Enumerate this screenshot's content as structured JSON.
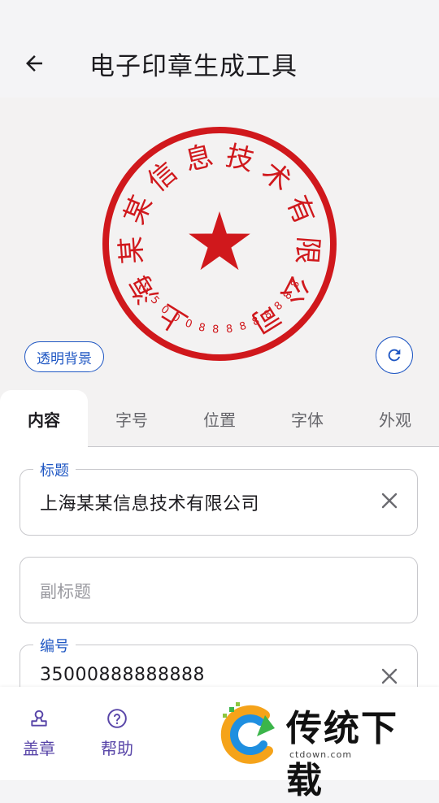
{
  "appbar": {
    "title": "电子印章生成工具"
  },
  "seal": {
    "title_text": "上海某某信息技术有限公司",
    "number_text": "35000888888888",
    "color": "#d0181c"
  },
  "preview": {
    "transparent_bg_label": "透明背景"
  },
  "tabs": [
    {
      "label": "内容",
      "active": true
    },
    {
      "label": "字号",
      "active": false
    },
    {
      "label": "位置",
      "active": false
    },
    {
      "label": "字体",
      "active": false
    },
    {
      "label": "外观",
      "active": false
    }
  ],
  "form": {
    "title_field": {
      "label": "标题",
      "value": "上海某某信息技术有限公司"
    },
    "subtitle_field": {
      "placeholder": "副标题"
    },
    "number_field": {
      "label": "编号",
      "value": "35000888888888"
    }
  },
  "bottom_nav": {
    "stamp_label": "盖章",
    "help_label": "帮助"
  },
  "watermark": {
    "text": "传统下载",
    "sub": "ctdown.com"
  },
  "colors": {
    "accent": "#1f57c3",
    "nav_purple": "#5845a8",
    "seal_red": "#d0181c"
  }
}
